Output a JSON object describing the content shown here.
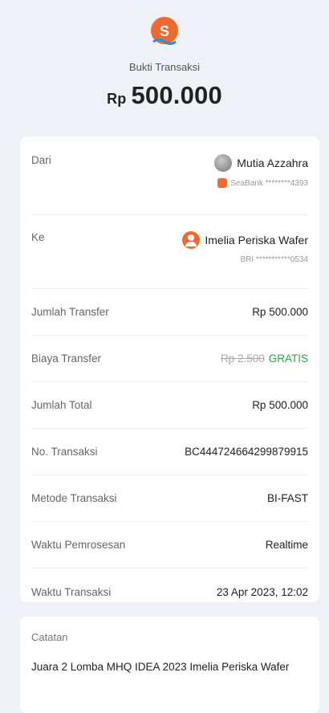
{
  "header": {
    "title": "Bukti Transaksi",
    "currency": "Rp",
    "amount": "500.000",
    "logo_icon": "seabank-logo-icon",
    "brand_color": "#ef6a2e"
  },
  "from": {
    "label": "Dari",
    "name": "Mutia Azzahra",
    "bank": "SeaBank",
    "account": "********4393"
  },
  "to": {
    "label": "Ke",
    "name": "Imelia Periska Wafer",
    "bank": "BRI",
    "account": "***********0534"
  },
  "details": {
    "jumlah_transfer_label": "Jumlah Transfer",
    "jumlah_transfer_value": "Rp 500.000",
    "biaya_label": "Biaya Transfer",
    "biaya_original": "Rp 2.500",
    "biaya_value": "GRATIS",
    "jumlah_total_label": "Jumlah Total",
    "jumlah_total_value": "Rp 500.000",
    "no_transaksi_label": "No. Transaksi",
    "no_transaksi_value": "BC444724664299879915",
    "metode_label": "Metode Transaksi",
    "metode_value": "BI-FAST",
    "waktu_proses_label": "Waktu Pemrosesan",
    "waktu_proses_value": "Realtime",
    "waktu_transaksi_label": "Waktu Transaksi",
    "waktu_transaksi_value": "23 Apr 2023, 12:02"
  },
  "note": {
    "label": "Catatan",
    "text": "Juara 2 Lomba MHQ IDEA 2023 Imelia Periska Wafer"
  }
}
